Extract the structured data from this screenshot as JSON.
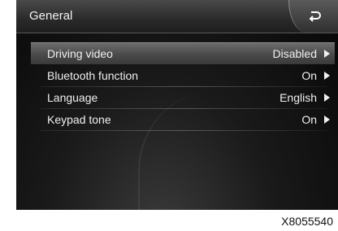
{
  "header": {
    "title": "General"
  },
  "menu": {
    "items": [
      {
        "label": "Driving video",
        "value": "Disabled",
        "selected": true
      },
      {
        "label": "Bluetooth function",
        "value": "On",
        "selected": false
      },
      {
        "label": "Language",
        "value": "English",
        "selected": false
      },
      {
        "label": "Keypad tone",
        "value": "On",
        "selected": false
      }
    ]
  },
  "footer": {
    "code": "X8055540"
  },
  "icons": {
    "back": "back-arrow-icon",
    "row_arrow": "arrow-right-icon"
  }
}
